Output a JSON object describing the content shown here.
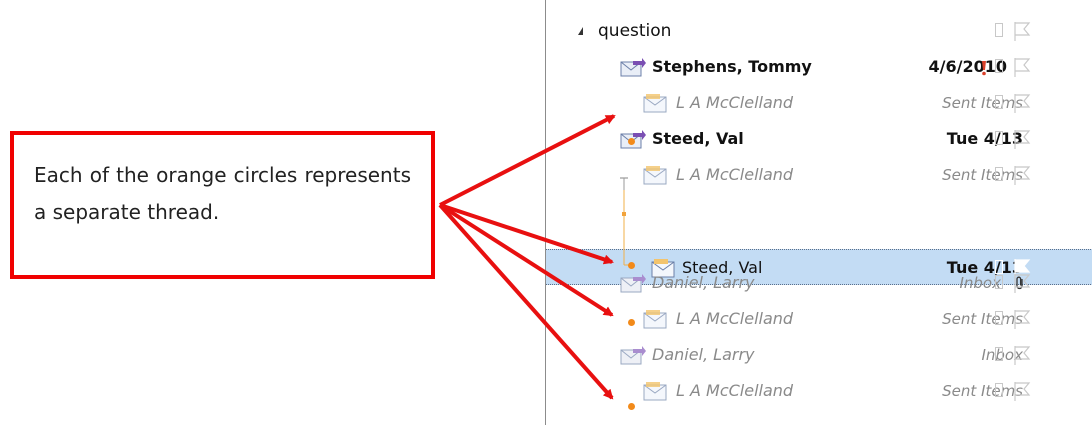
{
  "callout": {
    "text": "Each of the orange circles represents a separate thread."
  },
  "group": {
    "label": "question"
  },
  "messages": [
    {
      "sender": "Stephens, Tommy",
      "date": "4/6/2010",
      "folder": ""
    },
    {
      "sender": "L A McClelland",
      "date": "",
      "folder": "Sent Items"
    },
    {
      "sender": "Steed, Val",
      "date": "Tue 4/13",
      "folder": ""
    },
    {
      "sender": "L A McClelland",
      "date": "",
      "folder": "Sent Items"
    },
    {
      "sender": "Steed, Val",
      "date": "Tue 4/13",
      "folder": ""
    },
    {
      "sender": "Daniel, Larry",
      "date": "",
      "folder": "Inbox"
    },
    {
      "sender": "L A McClelland",
      "date": "",
      "folder": "Sent Items"
    },
    {
      "sender": "Daniel, Larry",
      "date": "",
      "folder": "Inbox"
    },
    {
      "sender": "L A McClelland",
      "date": "",
      "folder": "Sent Items"
    }
  ],
  "colors": {
    "accent_red": "#f00000",
    "thread_dot": "#f28a1a",
    "selection": "#c3dcf4"
  },
  "icons": [
    "collapse-triangle-icon",
    "envelope-reply-icon",
    "envelope-sent-icon",
    "importance-icon",
    "paperclip-icon",
    "flag-icon",
    "category-checkbox-icon"
  ]
}
